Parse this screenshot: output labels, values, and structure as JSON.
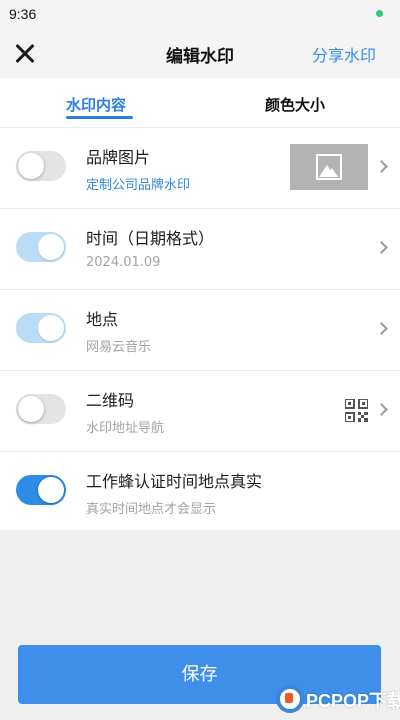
{
  "status": {
    "time": "9:36"
  },
  "header": {
    "title": "编辑水印",
    "share_label": "分享水印"
  },
  "tabs": [
    {
      "label": "水印内容",
      "active": true
    },
    {
      "label": "颜色大小",
      "active": false
    }
  ],
  "rows": [
    {
      "title": "品牌图片",
      "subtitle": "定制公司品牌水印",
      "toggle": "off",
      "extra": "image-placeholder-icon"
    },
    {
      "title": "时间（日期格式）",
      "subtitle": "2024.01.09",
      "toggle": "on-disabled"
    },
    {
      "title": "地点",
      "subtitle": "网易云音乐",
      "toggle": "on-disabled"
    },
    {
      "title": "二维码",
      "subtitle": "水印地址导航",
      "toggle": "off",
      "extra": "qr-code-icon"
    },
    {
      "title": "工作蜂认证时间地点真实",
      "subtitle": "真实时间地点才会显示",
      "toggle": "on"
    }
  ],
  "save_label": "保存",
  "watermark": {
    "text": "PCPOP下载"
  },
  "colors": {
    "accent": "#2f7fde",
    "button": "#3e8eea",
    "toggle_on": "#2e8be6",
    "toggle_disabled": "#bcdcf6"
  }
}
